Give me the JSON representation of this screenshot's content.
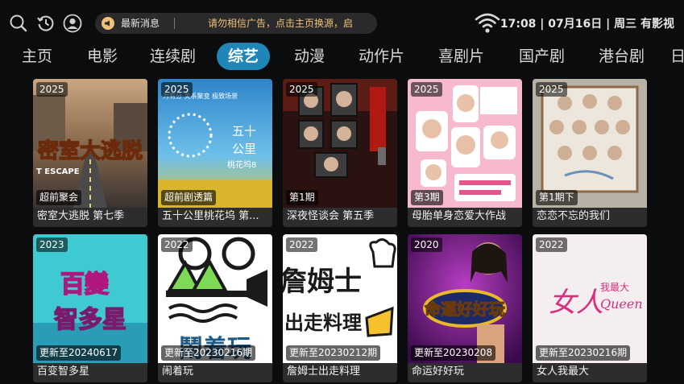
{
  "header": {
    "notice_title": "最新消息",
    "notice_text": "请勿相信广告，点击主页换源，启",
    "clock": "17:08 | 07月16日 | 周三",
    "app_name": "有影视"
  },
  "icons": {
    "search": "search-icon",
    "history": "history-icon",
    "user": "user-icon",
    "notice": "megaphone-icon",
    "wifi": "wifi-icon"
  },
  "colors": {
    "accent": "#1f86b7",
    "notice_text": "#f0c27a",
    "background": "#0b0c0e"
  },
  "categories": [
    "主页",
    "电影",
    "连续剧",
    "综艺",
    "动漫",
    "动作片",
    "喜剧片",
    "国产剧",
    "港台剧",
    "日"
  ],
  "active_category": "综艺",
  "cards": [
    {
      "year": "2025",
      "badge": "超前聚会",
      "title": "密室大逃脱 第七季"
    },
    {
      "year": "2025",
      "badge": "超前剧透篇",
      "title": "五十公里桃花坞 第..."
    },
    {
      "year": "2025",
      "badge": "第1期",
      "title": "深夜怪谈会 第五季"
    },
    {
      "year": "2025",
      "badge": "第3期",
      "title": "母胎单身恋爱大作战"
    },
    {
      "year": "2025",
      "badge": "第1期下",
      "title": "恋恋不忘的我们"
    },
    {
      "year": "2023",
      "badge": "更新至20240617",
      "title": "百变智多星"
    },
    {
      "year": "2022",
      "badge": "更新至20230216期",
      "title": "闹着玩"
    },
    {
      "year": "2022",
      "badge": "更新至20230212期",
      "title": "詹姆士出走料理"
    },
    {
      "year": "2020",
      "badge": "更新至20230208",
      "title": "命运好好玩"
    },
    {
      "year": "2022",
      "badge": "更新至20230216期",
      "title": "女人我最大"
    }
  ],
  "poster_text": {
    "p1": "密室大逃脱",
    "p1b": "T ESCAPE",
    "p2a": "五十",
    "p2b": "公里",
    "p2c": "桃花坞8",
    "p2d": "为有分 关系聚变 极致场景",
    "p6a": "百變",
    "p6b": "智多星",
    "p7": "鬧着玩",
    "p8a": "詹姆士",
    "p8b": "出走料理",
    "p9": "命運好好玩",
    "p10a": "女人",
    "p10b": "我最大",
    "p10c": "Queen"
  }
}
